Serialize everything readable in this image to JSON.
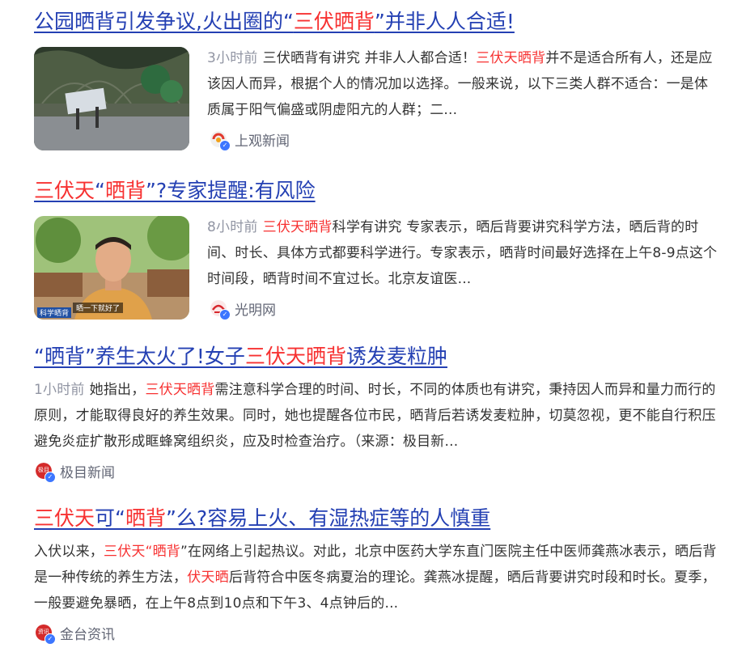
{
  "results": [
    {
      "title_parts": [
        "公园晒背引发争议,火出圈的“",
        "三伏晒背",
        "”并非人人合适!"
      ],
      "time": "3小时前",
      "snippet_parts": [
        "三伏晒背有讲究 并非人人都合适！",
        "三伏天晒背",
        "并不是适合所有人，还是应该因人而异，根据个人的情况加以选择。一般来说，以下三类人群不适合：一是体质属于阳气偏盛或阴虚阳亢的人群；二..."
      ],
      "source": "上观新闻",
      "thumb_icon": "park-photo-icon"
    },
    {
      "title_parts": [
        "三伏天",
        "“",
        "晒背",
        "”?专家提醒:有风险"
      ],
      "time": "8小时前",
      "snippet_parts": [
        "三伏天晒背",
        "科学有讲究 专家表示，晒后背要讲究科学方法，晒后背的时间、时长、具体方式都要科学进行。专家表示，晒背时间最好选择在上午8-9点这个时间段，晒背时间不宜过长。北京友谊医..."
      ],
      "source": "光明网",
      "thumb_caption": "晒一下就好了",
      "thumb_badge": "科学晒背"
    },
    {
      "title_parts": [
        "“晒背”养生太火了!女子",
        "三伏天晒背",
        "诱发麦粒肿"
      ],
      "time": "1小时前",
      "snippet_parts": [
        "她指出，",
        "三伏天晒背",
        "需注意科学合理的时间、时长，不同的体质也有讲究，秉持因人而异和量力而行的原则，才能取得良好的养生效果。同时，她也提醒各位市民，晒背后若诱发麦粒肿，切莫忽视，更不能自行积压避免炎症扩散形成眶蜂窝组织炎，应及时检查治疗。（来源：极目新..."
      ],
      "source": "极目新闻",
      "logo_text": "极目"
    },
    {
      "title_parts": [
        "三伏天",
        "可“",
        "晒背",
        "”么?容易上火、有湿热症等的人慎重"
      ],
      "snippet_parts": [
        "入伏以来，",
        "三伏天“晒背",
        "”在网络上引起热议。对此，北京中医药大学东直门医院主任中医师龚燕冰表示，晒后背是一种传统的养生方法，",
        "伏天晒",
        "后背符合中医冬病夏治的理论。龚燕冰提醒，晒后背要讲究时段和时长。夏季，一般要避免暴晒，在上午8点到10点和下午3、4点钟后的..."
      ],
      "source": "金台资讯",
      "logo_text": "资讯"
    }
  ]
}
